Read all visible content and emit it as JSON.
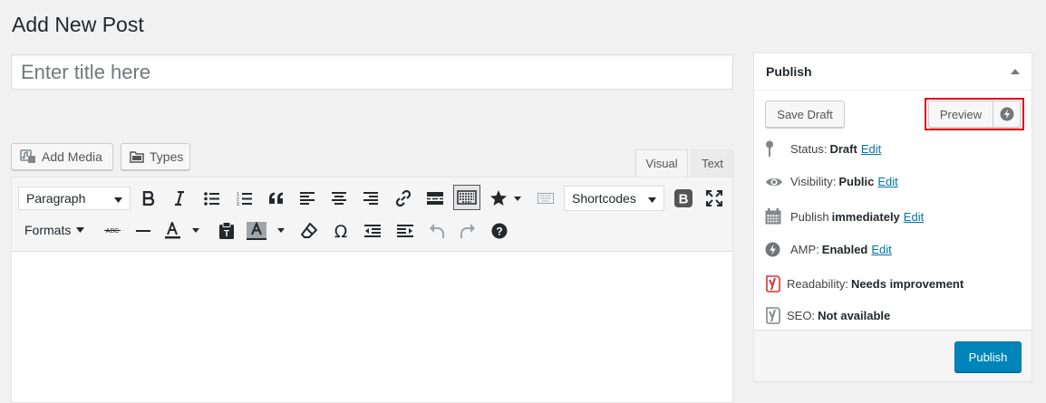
{
  "page": {
    "title": "Add New Post"
  },
  "title_field": {
    "placeholder": "Enter title here",
    "value": ""
  },
  "media_buttons": {
    "add_media": "Add Media",
    "types": "Types"
  },
  "editor_tabs": {
    "visual": "Visual",
    "text": "Text",
    "active": "visual"
  },
  "toolbar": {
    "format_select": "Paragraph",
    "shortcodes_select": "Shortcodes",
    "formats_menu": "Formats"
  },
  "publish_box": {
    "title": "Publish",
    "save_draft": "Save Draft",
    "preview": "Preview",
    "status": {
      "label": "Status:",
      "value": "Draft",
      "edit": "Edit"
    },
    "visibility": {
      "label": "Visibility:",
      "value": "Public",
      "edit": "Edit"
    },
    "schedule": {
      "label": "Publish",
      "value": "immediately",
      "edit": "Edit"
    },
    "amp": {
      "label": "AMP:",
      "value": "Enabled",
      "edit": "Edit"
    },
    "readability": {
      "label": "Readability:",
      "value": "Needs improvement"
    },
    "seo": {
      "label": "SEO:",
      "value": "Not available"
    },
    "publish_button": "Publish"
  },
  "colors": {
    "primary": "#0085ba",
    "link": "#0073aa",
    "highlight_border": "#e0001a",
    "yoast_red": "#dc3232"
  }
}
